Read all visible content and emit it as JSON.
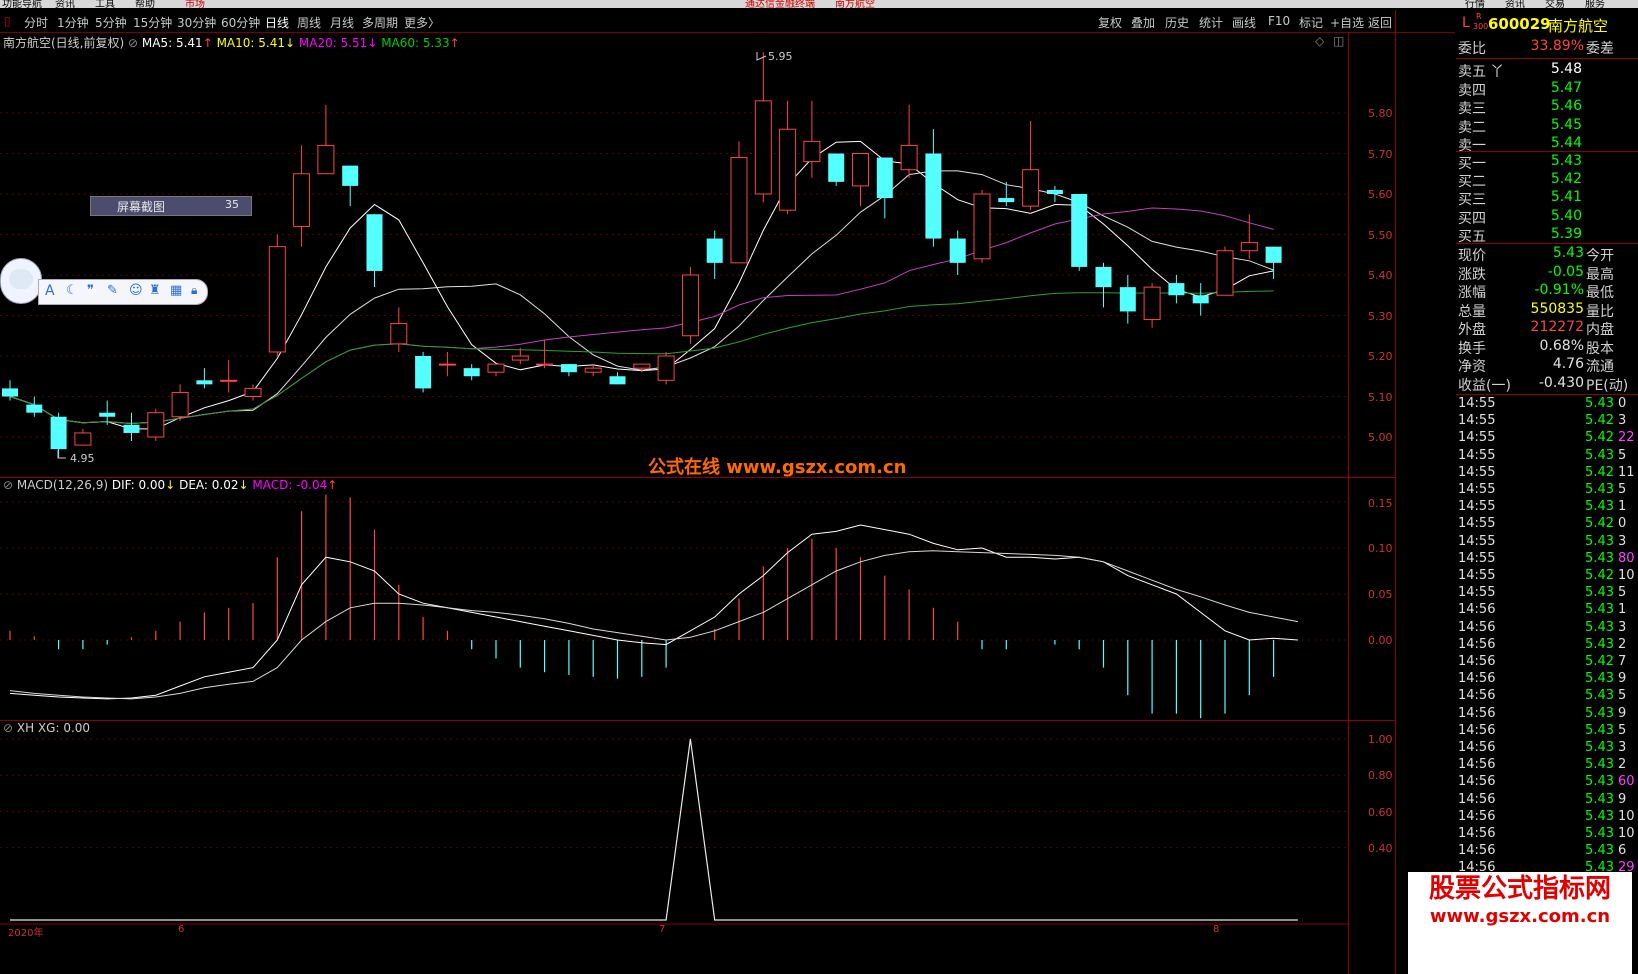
{
  "top_menu": [
    "功能导航",
    "资讯",
    "工具",
    "帮助",
    "市场",
    "通达信金融终端",
    "南方航空",
    "行情",
    "资讯",
    "交易",
    "服务"
  ],
  "toolbar": {
    "periods": [
      "分时",
      "1分钟",
      "5分钟",
      "15分钟",
      "30分钟",
      "60分钟",
      "日线",
      "周线",
      "月线",
      "多周期",
      "更多〉"
    ],
    "right_buttons": [
      "复权",
      "叠加",
      "历史",
      "统计",
      "画线",
      "F10",
      "标记",
      "+自选",
      "返回"
    ]
  },
  "main_legend": {
    "title": "南方航空(日线,前复权)",
    "ma5": "MA5: 5.41",
    "ma5_arrow": "↑",
    "ma10": "MA10: 5.41",
    "ma10_arrow": "↓",
    "ma20": "MA20: 5.51",
    "ma20_arrow": "↓",
    "ma60": "MA60: 5.33",
    "ma60_arrow": "↑"
  },
  "macd_legend": {
    "title": "MACD(12,26,9)",
    "dif": "DIF: 0.00",
    "dif_arrow": "↓",
    "dea": "DEA: 0.02",
    "dea_arrow": "↓",
    "macd": "MACD: -0.04",
    "macd_arrow": "↑"
  },
  "xh_legend": {
    "title": "XH XG: 0.00"
  },
  "price_axis": [
    "5.80",
    "5.70",
    "5.60",
    "5.50",
    "5.40",
    "5.30",
    "5.20",
    "5.10",
    "5.00"
  ],
  "macd_axis": [
    "0.15",
    "0.10",
    "0.05",
    "0.00"
  ],
  "xh_axis": [
    "1.00",
    "0.80",
    "0.60",
    "0.40"
  ],
  "annotations": {
    "high": "5.95",
    "low": "4.95"
  },
  "screenshot_label": {
    "text": "屏幕截图",
    "count": "35"
  },
  "watermark": "公式在线  www.gszx.com.cn",
  "date_axis": [
    "2020年",
    "6",
    "7",
    "8"
  ],
  "watermark2": {
    "line1": "股票公式指标网",
    "line2": "www.gszx.com.cn"
  },
  "colors": {
    "up": "#ff4444",
    "down": "#54ffff",
    "ma5": "#ffffff",
    "ma10": "#ffff00",
    "ma20": "#ff00ff",
    "ma60": "#00cc00",
    "grid_red": "#8b0000"
  },
  "chart_data": {
    "type": "candlestick",
    "ylim": [
      4.9,
      6.0
    ],
    "candles": [
      {
        "o": 5.12,
        "c": 5.1,
        "h": 5.14,
        "l": 5.09
      },
      {
        "o": 5.08,
        "c": 5.06,
        "h": 5.1,
        "l": 5.05
      },
      {
        "o": 5.05,
        "c": 4.97,
        "h": 5.06,
        "l": 4.95
      },
      {
        "o": 4.98,
        "c": 5.01,
        "h": 5.02,
        "l": 4.98
      },
      {
        "o": 5.06,
        "c": 5.05,
        "h": 5.09,
        "l": 5.03
      },
      {
        "o": 5.03,
        "c": 5.01,
        "h": 5.06,
        "l": 4.99
      },
      {
        "o": 5.0,
        "c": 5.06,
        "h": 5.07,
        "l": 4.99
      },
      {
        "o": 5.05,
        "c": 5.11,
        "h": 5.13,
        "l": 5.04
      },
      {
        "o": 5.14,
        "c": 5.13,
        "h": 5.17,
        "l": 5.12
      },
      {
        "o": 5.14,
        "c": 5.14,
        "h": 5.19,
        "l": 5.11
      },
      {
        "o": 5.1,
        "c": 5.12,
        "h": 5.13,
        "l": 5.09
      },
      {
        "o": 5.21,
        "c": 5.47,
        "h": 5.5,
        "l": 5.2
      },
      {
        "o": 5.52,
        "c": 5.65,
        "h": 5.72,
        "l": 5.47
      },
      {
        "o": 5.65,
        "c": 5.72,
        "h": 5.82,
        "l": 5.65
      },
      {
        "o": 5.67,
        "c": 5.62,
        "h": 5.67,
        "l": 5.57
      },
      {
        "o": 5.55,
        "c": 5.41,
        "h": 5.55,
        "l": 5.37
      },
      {
        "o": 5.23,
        "c": 5.28,
        "h": 5.32,
        "l": 5.21
      },
      {
        "o": 5.2,
        "c": 5.12,
        "h": 5.21,
        "l": 5.11
      },
      {
        "o": 5.18,
        "c": 5.18,
        "h": 5.21,
        "l": 5.15
      },
      {
        "o": 5.17,
        "c": 5.15,
        "h": 5.18,
        "l": 5.14
      },
      {
        "o": 5.16,
        "c": 5.18,
        "h": 5.18,
        "l": 5.15
      },
      {
        "o": 5.19,
        "c": 5.2,
        "h": 5.22,
        "l": 5.18
      },
      {
        "o": 5.18,
        "c": 5.18,
        "h": 5.24,
        "l": 5.17
      },
      {
        "o": 5.18,
        "c": 5.16,
        "h": 5.18,
        "l": 5.15
      },
      {
        "o": 5.16,
        "c": 5.17,
        "h": 5.18,
        "l": 5.15
      },
      {
        "o": 5.15,
        "c": 5.13,
        "h": 5.16,
        "l": 5.13
      },
      {
        "o": 5.17,
        "c": 5.18,
        "h": 5.18,
        "l": 5.16
      },
      {
        "o": 5.14,
        "c": 5.2,
        "h": 5.21,
        "l": 5.13
      },
      {
        "o": 5.25,
        "c": 5.4,
        "h": 5.42,
        "l": 5.23
      },
      {
        "o": 5.49,
        "c": 5.43,
        "h": 5.51,
        "l": 5.39
      },
      {
        "o": 5.43,
        "c": 5.69,
        "h": 5.73,
        "l": 5.43
      },
      {
        "o": 5.6,
        "c": 5.83,
        "h": 5.95,
        "l": 5.58
      },
      {
        "o": 5.56,
        "c": 5.76,
        "h": 5.83,
        "l": 5.55
      },
      {
        "o": 5.68,
        "c": 5.73,
        "h": 5.83,
        "l": 5.64
      },
      {
        "o": 5.7,
        "c": 5.63,
        "h": 5.7,
        "l": 5.62
      },
      {
        "o": 5.62,
        "c": 5.7,
        "h": 5.7,
        "l": 5.57
      },
      {
        "o": 5.69,
        "c": 5.59,
        "h": 5.69,
        "l": 5.54
      },
      {
        "o": 5.66,
        "c": 5.72,
        "h": 5.82,
        "l": 5.64
      },
      {
        "o": 5.7,
        "c": 5.49,
        "h": 5.76,
        "l": 5.47
      },
      {
        "o": 5.49,
        "c": 5.43,
        "h": 5.51,
        "l": 5.4
      },
      {
        "o": 5.44,
        "c": 5.6,
        "h": 5.61,
        "l": 5.43
      },
      {
        "o": 5.59,
        "c": 5.58,
        "h": 5.63,
        "l": 5.57
      },
      {
        "o": 5.57,
        "c": 5.66,
        "h": 5.78,
        "l": 5.56
      },
      {
        "o": 5.61,
        "c": 5.6,
        "h": 5.62,
        "l": 5.58
      },
      {
        "o": 5.6,
        "c": 5.42,
        "h": 5.6,
        "l": 5.41
      },
      {
        "o": 5.42,
        "c": 5.37,
        "h": 5.43,
        "l": 5.32
      },
      {
        "o": 5.37,
        "c": 5.31,
        "h": 5.4,
        "l": 5.28
      },
      {
        "o": 5.29,
        "c": 5.37,
        "h": 5.38,
        "l": 5.27
      },
      {
        "o": 5.38,
        "c": 5.35,
        "h": 5.4,
        "l": 5.33
      },
      {
        "o": 5.35,
        "c": 5.33,
        "h": 5.38,
        "l": 5.3
      },
      {
        "o": 5.35,
        "c": 5.46,
        "h": 5.47,
        "l": 5.35
      },
      {
        "o": 5.46,
        "c": 5.48,
        "h": 5.55,
        "l": 5.44
      },
      {
        "o": 5.47,
        "c": 5.43,
        "h": 5.47,
        "l": 5.39
      }
    ],
    "macd_ylim": [
      -0.08,
      0.16
    ],
    "macd_hist": [
      0.01,
      0.004,
      -0.01,
      -0.01,
      -0.005,
      0.003,
      0.01,
      0.02,
      0.03,
      0.035,
      0.04,
      0.09,
      0.14,
      0.158,
      0.155,
      0.12,
      0.06,
      0.025,
      0.01,
      -0.01,
      -0.02,
      -0.03,
      -0.035,
      -0.038,
      -0.04,
      -0.042,
      -0.04,
      -0.03,
      0.0,
      0.012,
      0.045,
      0.08,
      0.1,
      0.11,
      0.1,
      0.09,
      0.07,
      0.055,
      0.035,
      0.02,
      -0.01,
      -0.01,
      0.0,
      -0.005,
      -0.01,
      -0.03,
      -0.06,
      -0.08,
      -0.08,
      -0.085,
      -0.08,
      -0.06,
      -0.04,
      -0.04
    ],
    "dif": [
      -0.058,
      -0.06,
      -0.062,
      -0.063,
      -0.064,
      -0.063,
      -0.06,
      -0.05,
      -0.04,
      -0.035,
      -0.03,
      0.0,
      0.06,
      0.09,
      0.085,
      0.075,
      0.05,
      0.04,
      0.035,
      0.03,
      0.025,
      0.02,
      0.015,
      0.01,
      0.005,
      0.0,
      -0.003,
      -0.005,
      0.01,
      0.025,
      0.05,
      0.07,
      0.095,
      0.115,
      0.118,
      0.125,
      0.12,
      0.115,
      0.105,
      0.098,
      0.1,
      0.09,
      0.09,
      0.088,
      0.09,
      0.085,
      0.07,
      0.06,
      0.05,
      0.03,
      0.01,
      0.0,
      0.002,
      0.0
    ],
    "dea": [
      -0.055,
      -0.058,
      -0.06,
      -0.062,
      -0.063,
      -0.064,
      -0.062,
      -0.058,
      -0.052,
      -0.048,
      -0.045,
      -0.03,
      0.0,
      0.02,
      0.035,
      0.04,
      0.04,
      0.038,
      0.035,
      0.032,
      0.03,
      0.027,
      0.023,
      0.018,
      0.012,
      0.008,
      0.004,
      0.0,
      0.003,
      0.01,
      0.02,
      0.03,
      0.045,
      0.06,
      0.075,
      0.085,
      0.092,
      0.096,
      0.097,
      0.096,
      0.095,
      0.094,
      0.093,
      0.092,
      0.09,
      0.085,
      0.075,
      0.065,
      0.055,
      0.047,
      0.038,
      0.03,
      0.025,
      0.02
    ],
    "xg_ylim": [
      0,
      1.0
    ],
    "xg": [
      0,
      0,
      0,
      0,
      0,
      0,
      0,
      0,
      0,
      0,
      0,
      0,
      0,
      0,
      0,
      0,
      0,
      0,
      0,
      0,
      0,
      0,
      0,
      0,
      0,
      0,
      0,
      0,
      1,
      0,
      0,
      0,
      0,
      0,
      0,
      0,
      0,
      0,
      0,
      0,
      0,
      0,
      0,
      0,
      0,
      0,
      0,
      0,
      0,
      0,
      0,
      0,
      0,
      0
    ]
  },
  "quote_panel": {
    "code_letter": "L",
    "code_sub": "R",
    "code_sub2": "300",
    "code": "600029",
    "name": "南方航空",
    "wb_label": "委比",
    "wb_value": "33.89%",
    "wc_label": "委差",
    "asks": [
      {
        "label": "卖五",
        "price": "5.48",
        "mark": "丫"
      },
      {
        "label": "卖四",
        "price": "5.47"
      },
      {
        "label": "卖三",
        "price": "5.46"
      },
      {
        "label": "卖二",
        "price": "5.45"
      },
      {
        "label": "卖一",
        "price": "5.44"
      }
    ],
    "bids": [
      {
        "label": "买一",
        "price": "5.43"
      },
      {
        "label": "买二",
        "price": "5.42"
      },
      {
        "label": "买三",
        "price": "5.41"
      },
      {
        "label": "买四",
        "price": "5.40"
      },
      {
        "label": "买五",
        "price": "5.39"
      }
    ],
    "stats": [
      {
        "label": "现价",
        "value": "5.43",
        "label2": "今开",
        "color": "#00ff00"
      },
      {
        "label": "涨跌",
        "value": "-0.05",
        "label2": "最高",
        "color": "#00ff00"
      },
      {
        "label": "涨幅",
        "value": "-0.91%",
        "label2": "最低",
        "color": "#00ff00"
      },
      {
        "label": "总量",
        "value": "550835",
        "label2": "量比",
        "color": "#ffff00"
      },
      {
        "label": "外盘",
        "value": "212272",
        "label2": "内盘",
        "color": "#ff4444"
      },
      {
        "label": "换手",
        "value": "0.68%",
        "label2": "股本",
        "color": "#e0e0e0"
      },
      {
        "label": "净资",
        "value": "4.76",
        "label2": "流通",
        "color": "#e0e0e0"
      },
      {
        "label": "收益(一)",
        "value": "-0.430",
        "label2": "PE(动)",
        "color": "#e0e0e0"
      }
    ],
    "ticks": [
      {
        "t": "14:55",
        "p": "5.43",
        "v": "0"
      },
      {
        "t": "14:55",
        "p": "5.42",
        "v": "3"
      },
      {
        "t": "14:55",
        "p": "5.42",
        "v": "22"
      },
      {
        "t": "14:55",
        "p": "5.43",
        "v": "5"
      },
      {
        "t": "14:55",
        "p": "5.42",
        "v": "11"
      },
      {
        "t": "14:55",
        "p": "5.43",
        "v": "5"
      },
      {
        "t": "14:55",
        "p": "5.43",
        "v": "1"
      },
      {
        "t": "14:55",
        "p": "5.42",
        "v": "0"
      },
      {
        "t": "14:55",
        "p": "5.43",
        "v": "3"
      },
      {
        "t": "14:55",
        "p": "5.43",
        "v": "80"
      },
      {
        "t": "14:55",
        "p": "5.42",
        "v": "10"
      },
      {
        "t": "14:55",
        "p": "5.43",
        "v": "5"
      },
      {
        "t": "14:56",
        "p": "5.43",
        "v": "1"
      },
      {
        "t": "14:56",
        "p": "5.43",
        "v": "3"
      },
      {
        "t": "14:56",
        "p": "5.43",
        "v": "2"
      },
      {
        "t": "14:56",
        "p": "5.42",
        "v": "7"
      },
      {
        "t": "14:56",
        "p": "5.43",
        "v": "9"
      },
      {
        "t": "14:56",
        "p": "5.43",
        "v": "5"
      },
      {
        "t": "14:56",
        "p": "5.43",
        "v": "9"
      },
      {
        "t": "14:56",
        "p": "5.43",
        "v": "5"
      },
      {
        "t": "14:56",
        "p": "5.43",
        "v": "3"
      },
      {
        "t": "14:56",
        "p": "5.43",
        "v": "2"
      },
      {
        "t": "14:56",
        "p": "5.43",
        "v": "60"
      },
      {
        "t": "14:56",
        "p": "5.43",
        "v": "9"
      },
      {
        "t": "14:56",
        "p": "5.43",
        "v": "10"
      },
      {
        "t": "14:56",
        "p": "5.43",
        "v": "10"
      },
      {
        "t": "14:56",
        "p": "5.43",
        "v": "6"
      },
      {
        "t": "14:56",
        "p": "5.43",
        "v": "29"
      }
    ]
  }
}
